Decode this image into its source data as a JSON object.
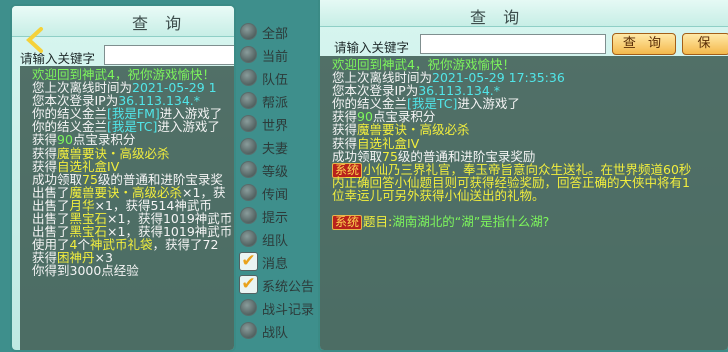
{
  "left_panel": {
    "title": "查 询",
    "search_label": "请输入关键字",
    "lines": [
      [
        {
          "t": "欢迎回到神武4，祝你游戏愉快！",
          "c": "g"
        }
      ],
      [
        {
          "t": "您上次离线时间为"
        },
        {
          "t": "2021-05-29 1",
          "c": "b"
        }
      ],
      [
        {
          "t": "您本次登录IP为"
        },
        {
          "t": "36.113.134.*",
          "c": "b"
        }
      ],
      [
        {
          "t": "你的结义金兰"
        },
        {
          "t": "[我是FM]",
          "c": "b"
        },
        {
          "t": "进入游戏了"
        }
      ],
      [
        {
          "t": "你的结义金兰"
        },
        {
          "t": "[我是TC]",
          "c": "b"
        },
        {
          "t": "进入游戏了"
        }
      ],
      [
        {
          "t": "获得"
        },
        {
          "t": "90",
          "c": "g"
        },
        {
          "t": "点宝录积分"
        }
      ],
      [
        {
          "t": "获得"
        },
        {
          "t": "魔兽要诀・高级必杀",
          "c": "y"
        }
      ],
      [
        {
          "t": "获得"
        },
        {
          "t": "自选礼盒IV",
          "c": "y"
        }
      ],
      [
        {
          "t": "成功领取"
        },
        {
          "t": "75",
          "c": "y"
        },
        {
          "t": "级的普通和进阶宝录奖"
        }
      ],
      [
        {
          "t": "出售了"
        },
        {
          "t": "魔兽要诀・高级必杀",
          "c": "y"
        },
        {
          "t": "×1，获"
        }
      ],
      [
        {
          "t": "出售了"
        },
        {
          "t": "月华",
          "c": "y"
        },
        {
          "t": "×1，获得514神武币"
        }
      ],
      [
        {
          "t": "出售了"
        },
        {
          "t": "黑宝石",
          "c": "y"
        },
        {
          "t": "×1，获得1019神武币"
        }
      ],
      [
        {
          "t": "出售了"
        },
        {
          "t": "黑宝石",
          "c": "y"
        },
        {
          "t": "×1，获得1019神武币"
        }
      ],
      [
        {
          "t": "使用了"
        },
        {
          "t": "4",
          "c": "y"
        },
        {
          "t": "个"
        },
        {
          "t": "神武币礼袋",
          "c": "y"
        },
        {
          "t": "，获得了72"
        }
      ],
      [
        {
          "t": "获得"
        },
        {
          "t": "困神丹",
          "c": "y"
        },
        {
          "t": "×3"
        }
      ],
      [
        {
          "t": "你得到3000点经验"
        }
      ]
    ]
  },
  "right_panel": {
    "title": "查 询",
    "search_label": "请输入关键字",
    "search_value": "",
    "query_button": "查 询",
    "save_button": "保",
    "lines": [
      [
        {
          "t": "欢迎回到神武4，祝你游戏愉快！",
          "c": "g"
        }
      ],
      [
        {
          "t": "您上次离线时间为"
        },
        {
          "t": "2021-05-29 17:35:36",
          "c": "b"
        }
      ],
      [
        {
          "t": "您本次登录IP为"
        },
        {
          "t": "36.113.134.*",
          "c": "b"
        }
      ],
      [
        {
          "t": "你的结义金兰"
        },
        {
          "t": "[我是TC]",
          "c": "b"
        },
        {
          "t": "进入游戏了"
        }
      ],
      [
        {
          "t": "获得"
        },
        {
          "t": "90",
          "c": "g"
        },
        {
          "t": "点宝录积分"
        }
      ],
      [
        {
          "t": "获得"
        },
        {
          "t": "魔兽要诀・高级必杀",
          "c": "y"
        }
      ],
      [
        {
          "t": "获得"
        },
        {
          "t": "自选礼盒IV",
          "c": "y"
        }
      ],
      [
        {
          "t": "成功领取"
        },
        {
          "t": "75",
          "c": "y"
        },
        {
          "t": "级的普通和进阶宝录奖励"
        }
      ],
      [
        {
          "tag": "系统"
        },
        {
          "t": "小仙乃三界礼官，奉玉帝旨意向众生送礼。在世界频道60秒",
          "c": "y"
        }
      ],
      [
        {
          "t": "内正确回答小仙题目则可获得经验奖励，回答正确的大侠中将有1",
          "c": "y"
        }
      ],
      [
        {
          "t": "位幸运儿可另外获得小仙送出的礼物。",
          "c": "y"
        }
      ],
      [
        {
          "t": ""
        }
      ],
      [
        {
          "tag": "系统"
        },
        {
          "t": "题目:",
          "c": "y"
        },
        {
          "t": "湖南湖北的“湖”是指什么湖?",
          "c": "g"
        }
      ]
    ]
  },
  "sidebar": {
    "items": [
      {
        "label": "全部",
        "type": "radio"
      },
      {
        "label": "当前",
        "type": "radio"
      },
      {
        "label": "队伍",
        "type": "radio"
      },
      {
        "label": "帮派",
        "type": "radio"
      },
      {
        "label": "世界",
        "type": "radio"
      },
      {
        "label": "夫妻",
        "type": "radio"
      },
      {
        "label": "等级",
        "type": "radio"
      },
      {
        "label": "传闻",
        "type": "radio"
      },
      {
        "label": "提示",
        "type": "radio"
      },
      {
        "label": "组队",
        "type": "radio"
      },
      {
        "label": "消息",
        "type": "check"
      },
      {
        "label": "系统公告",
        "type": "check"
      },
      {
        "label": "战斗记录",
        "type": "radio"
      },
      {
        "label": "战队",
        "type": "radio"
      }
    ]
  },
  "icons": {
    "back": "chevron-left-icon",
    "check": "checkmark-icon"
  },
  "colors": {
    "green": "#7df55c",
    "yellow": "#f2ee3d",
    "cyan": "#51e6e9",
    "tag_bg": "#b8221c"
  }
}
